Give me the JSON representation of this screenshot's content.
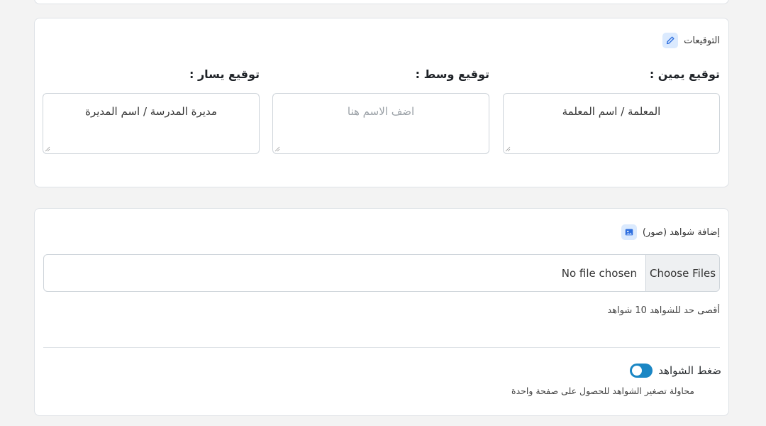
{
  "signatures": {
    "section_title": "التوقيعات",
    "section_icon": "pencil-icon",
    "right": {
      "label": "توقيع يمين :",
      "value": "المعلمة / اسم المعلمة"
    },
    "middle": {
      "label": "توقيع وسط :",
      "value": "",
      "placeholder": "اضف الاسم هنا"
    },
    "left": {
      "label": "توقيع يسار :",
      "value": "مديرة المدرسة / اسم المديرة"
    }
  },
  "evidence": {
    "section_title": "إضافة شواهد (صور)",
    "section_icon": "image-icon",
    "file_button_label": "Choose Files",
    "file_status": "No file chosen",
    "hint": "أقصى حد للشواهد 10 شواهد",
    "compress": {
      "label": "ضغط الشواهد",
      "description": "محاولة تصغير الشواهد للحصول على صفحة واحدة",
      "enabled": true
    }
  },
  "colors": {
    "accent": "#1a86c4",
    "icon_bg": "#dbeafe",
    "page_bg": "#f3f3f3"
  }
}
